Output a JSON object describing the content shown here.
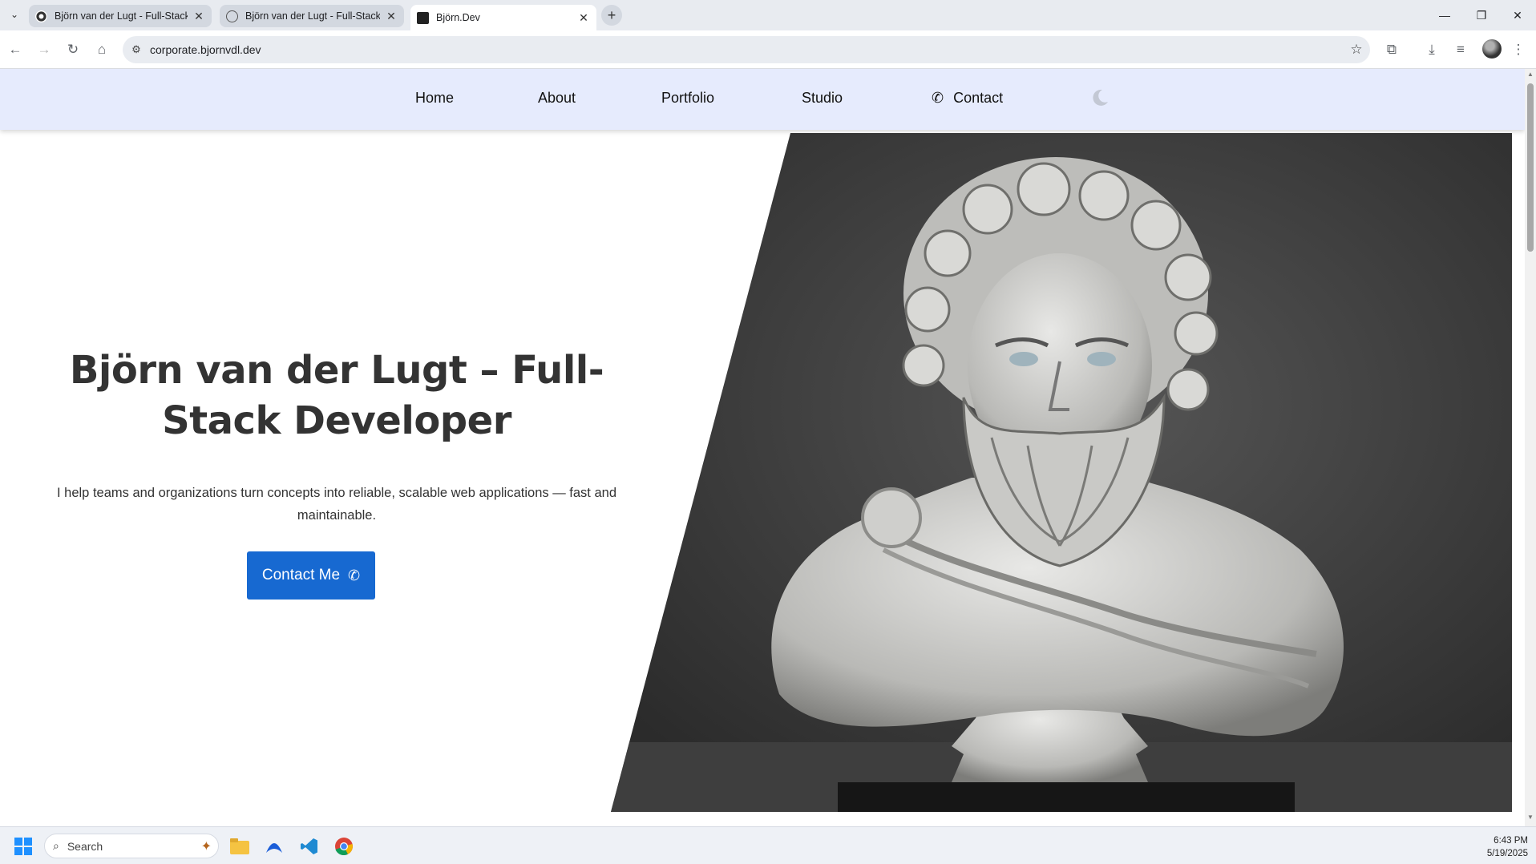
{
  "browser": {
    "tabs": [
      {
        "title": "Björn van der Lugt - Full-Stack D",
        "active": false
      },
      {
        "title": "Björn van der Lugt - Full-Stack D",
        "active": false
      },
      {
        "title": "Björn.Dev",
        "active": true
      }
    ],
    "url": "corporate.bjornvdl.dev"
  },
  "site": {
    "nav": {
      "home": "Home",
      "about": "About",
      "portfolio": "Portfolio",
      "studio": "Studio",
      "contact": "Contact"
    },
    "hero": {
      "title_line1": "Björn van der Lugt – Full-",
      "title_line2": "Stack Developer",
      "subtitle_line1": "I help teams and organizations turn concepts into reliable, scalable web applications — fast and",
      "subtitle_line2": "maintainable.",
      "cta_label": "Contact Me"
    }
  },
  "taskbar": {
    "search_label": "Search",
    "time": "6:43 PM",
    "date": "5/19/2025"
  },
  "colors": {
    "nav_bg": "#e6ebfd",
    "cta_bg": "#1769d1",
    "title_text": "#333333",
    "hero_image_bg": "#3a3a3a"
  }
}
